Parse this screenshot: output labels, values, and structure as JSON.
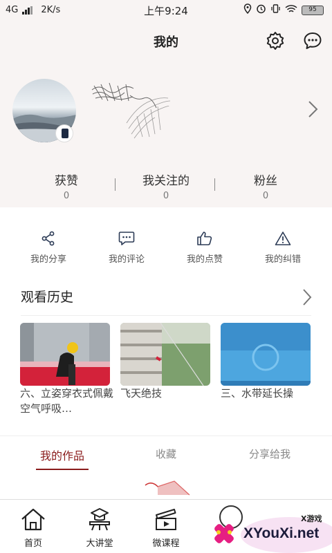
{
  "status_bar": {
    "network": "4G",
    "speed": "2K/s",
    "time": "上午9:24",
    "battery": "95"
  },
  "header": {
    "title": "我的"
  },
  "stats": [
    {
      "label": "获赞",
      "value": "0"
    },
    {
      "label": "我关注的",
      "value": "0"
    },
    {
      "label": "粉丝",
      "value": "0"
    }
  ],
  "quick_actions": [
    {
      "label": "我的分享",
      "icon": "share-icon"
    },
    {
      "label": "我的评论",
      "icon": "comment-icon"
    },
    {
      "label": "我的点赞",
      "icon": "thumbs-up-icon"
    },
    {
      "label": "我的纠错",
      "icon": "warning-icon"
    }
  ],
  "history": {
    "title": "观看历史",
    "items": [
      {
        "caption": "六、立姿穿衣式佩戴空气呼吸…"
      },
      {
        "caption": "飞天绝技"
      },
      {
        "caption": "三、水带延长操"
      }
    ]
  },
  "tabs": [
    {
      "label": "我的作品",
      "active": true
    },
    {
      "label": "收藏",
      "active": false
    },
    {
      "label": "分享给我",
      "active": false
    }
  ],
  "bottom_nav": [
    {
      "label": "首页",
      "icon": "home-icon"
    },
    {
      "label": "大讲堂",
      "icon": "lecture-icon"
    },
    {
      "label": "微课程",
      "icon": "play-course-icon"
    }
  ],
  "watermark": {
    "site": "XYouXi.net",
    "brand": "X游戏"
  },
  "colors": {
    "header_bg": "#f8f4f3",
    "accent": "#8a1b1b"
  }
}
